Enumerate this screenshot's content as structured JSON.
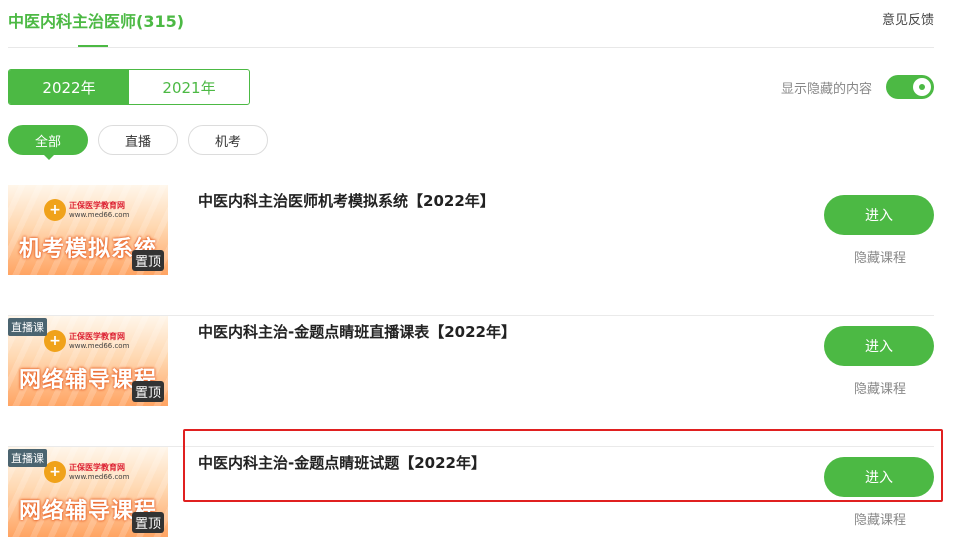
{
  "header": {
    "title": "中医内科主治医师(315)",
    "feedback": "意见反馈"
  },
  "year_tabs": [
    {
      "label": "2022年",
      "selected": true
    },
    {
      "label": "2021年",
      "selected": false
    }
  ],
  "hidden_toggle": {
    "label": "显示隐藏的内容",
    "on": true
  },
  "filters": [
    {
      "label": "全部",
      "selected": true
    },
    {
      "label": "直播",
      "selected": false
    },
    {
      "label": "机考",
      "selected": false
    }
  ],
  "courses": [
    {
      "title": "中医内科主治医师机考模拟系统【2022年】",
      "thumb_banner": "机考模拟系统",
      "logo_name": "正保医学教育网",
      "logo_url": "www.med66.com",
      "live_badge": "",
      "pin_badge": "置顶",
      "enter": "进入",
      "hide": "隐藏课程"
    },
    {
      "title": "中医内科主治-金题点睛班直播课表【2022年】",
      "thumb_banner": "网络辅导课程",
      "logo_name": "正保医学教育网",
      "logo_url": "www.med66.com",
      "live_badge": "直播课",
      "pin_badge": "置顶",
      "enter": "进入",
      "hide": "隐藏课程"
    },
    {
      "title": "中医内科主治-金题点睛班试题【2022年】",
      "thumb_banner": "网络辅导课程",
      "logo_name": "正保医学教育网",
      "logo_url": "www.med66.com",
      "live_badge": "直播课",
      "pin_badge": "置顶",
      "enter": "进入",
      "hide": "隐藏课程"
    }
  ],
  "colors": {
    "accent": "#4cb944",
    "highlight": "#e02020"
  }
}
